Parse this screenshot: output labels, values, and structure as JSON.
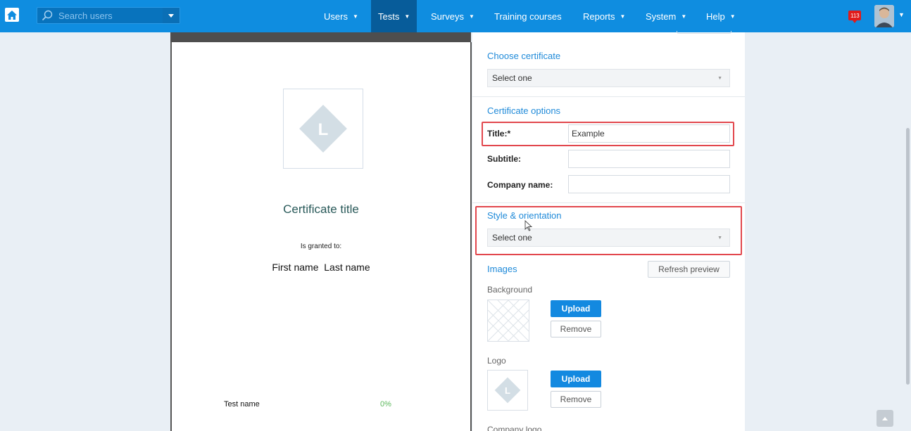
{
  "nav": {
    "search_placeholder": "Search users",
    "items": [
      {
        "label": "Users",
        "caret": "▼"
      },
      {
        "label": "Tests",
        "caret": "▼"
      },
      {
        "label": "Surveys",
        "caret": "▼"
      },
      {
        "label": "Training courses",
        "caret": ""
      },
      {
        "label": "Reports",
        "caret": "▼"
      },
      {
        "label": "System",
        "caret": "▼"
      },
      {
        "label": "Help",
        "caret": "▼"
      }
    ],
    "active_item": "Tests",
    "notification_count": "113",
    "accent_color": "#0f8de0"
  },
  "preview": {
    "logo_letter": "L",
    "title": "Certificate title",
    "granted_text": "Is granted to:",
    "recipient": "First name  Last name",
    "test_name": "Test name",
    "score": "0%"
  },
  "panel": {
    "choose_certificate": {
      "heading": "Choose certificate",
      "select_value": "Select one"
    },
    "certificate_options": {
      "heading": "Certificate options",
      "title_label": "Title:*",
      "title_value": "Example",
      "subtitle_label": "Subtitle:",
      "subtitle_value": "",
      "company_label": "Company name:",
      "company_value": ""
    },
    "style": {
      "heading": "Style & orientation",
      "select_value": "Select one"
    },
    "images": {
      "heading": "Images",
      "refresh_label": "Refresh preview",
      "background_label": "Background",
      "logo_label": "Logo",
      "company_logo_label": "Company logo",
      "upload_label": "Upload",
      "remove_label": "Remove",
      "logo_letter": "L"
    }
  },
  "highlight_color": "#e2474d"
}
